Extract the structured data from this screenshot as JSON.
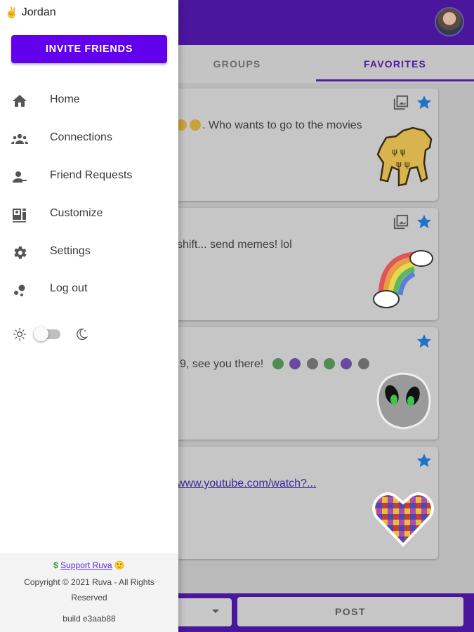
{
  "drawer": {
    "user_emoji": "✌",
    "user_name": "Jordan",
    "invite_label": "INVITE FRIENDS",
    "nav": [
      {
        "label": "Home",
        "icon": "home-icon"
      },
      {
        "label": "Connections",
        "icon": "people-icon"
      },
      {
        "label": "Friend Requests",
        "icon": "person-request-icon"
      },
      {
        "label": "Customize",
        "icon": "customize-icon"
      },
      {
        "label": "Settings",
        "icon": "gear-icon"
      },
      {
        "label": "Log out",
        "icon": "logout-icon"
      }
    ],
    "theme_dark_enabled": false,
    "footer": {
      "support_prefix": "$",
      "support_link": "Support Ruva",
      "support_suffix": "🙂",
      "copyright": "Copyright © 2021 Ruva - All Rights Reserved",
      "build": "build e3aab88"
    }
  },
  "tabs": {
    "groups": "GROUPS",
    "favorites": "FAVORITES",
    "selected": "FAVORITES"
  },
  "posts": [
    {
      "text_suffix": ". Who wants to go to the movies",
      "sticker": "yellow-dog-sticker",
      "starred": true,
      "has_gallery": true
    },
    {
      "text": "shift... send memes! lol",
      "sticker": "rainbow-sticker",
      "starred": true,
      "has_gallery": true
    },
    {
      "text": "9, see you there!",
      "sticker": "alien-sticker",
      "starred": true,
      "has_gallery": false
    },
    {
      "link": "www.youtube.com/watch?...",
      "sticker": "pixel-heart-sticker",
      "starred": true,
      "has_gallery": false
    }
  ],
  "composer": {
    "post_label": "POST"
  },
  "colors": {
    "primary": "#6200ee",
    "appbar": "#4a169e",
    "star": "#1e88e5"
  }
}
